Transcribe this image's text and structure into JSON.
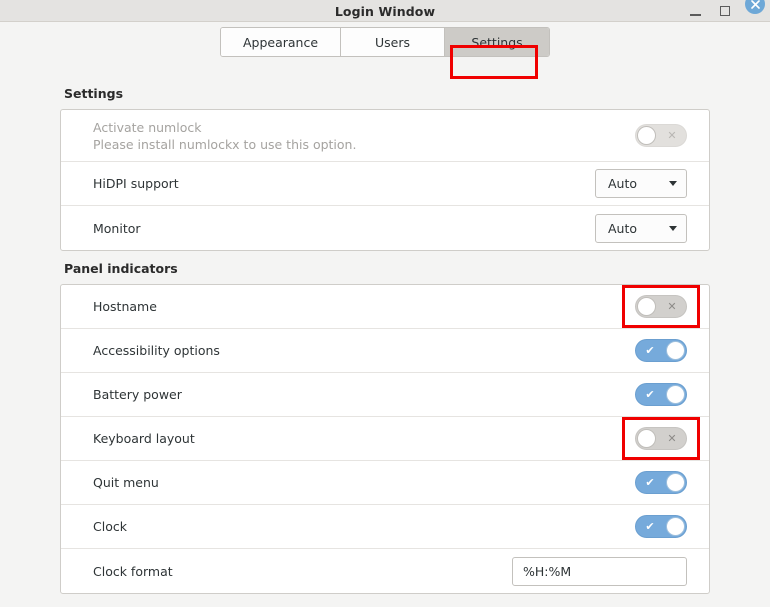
{
  "window": {
    "title": "Login Window",
    "controls": {
      "minimize": "minimize",
      "maximize": "maximize",
      "close": "close"
    }
  },
  "tabs": [
    {
      "label": "Appearance",
      "selected": false
    },
    {
      "label": "Users",
      "selected": false
    },
    {
      "label": "Settings",
      "selected": true,
      "highlighted": true
    }
  ],
  "sections": [
    {
      "title": "Settings",
      "rows": [
        {
          "label": "Activate numlock",
          "sublabel": "Please install numlockx to use this option.",
          "disabled": true,
          "control": "switch",
          "value": "off",
          "highlighted": false
        },
        {
          "label": "HiDPI support",
          "control": "dropdown",
          "value": "Auto",
          "highlighted": false
        },
        {
          "label": "Monitor",
          "control": "dropdown",
          "value": "Auto",
          "highlighted": false
        }
      ]
    },
    {
      "title": "Panel indicators",
      "rows": [
        {
          "label": "Hostname",
          "control": "switch",
          "value": "off",
          "highlighted": true
        },
        {
          "label": "Accessibility options",
          "control": "switch",
          "value": "on",
          "highlighted": false
        },
        {
          "label": "Battery power",
          "control": "switch",
          "value": "on",
          "highlighted": false
        },
        {
          "label": "Keyboard layout",
          "control": "switch",
          "value": "off",
          "highlighted": true
        },
        {
          "label": "Quit menu",
          "control": "switch",
          "value": "on",
          "highlighted": false
        },
        {
          "label": "Clock",
          "control": "switch",
          "value": "on",
          "highlighted": false
        },
        {
          "label": "Clock format",
          "control": "input",
          "value": "%H:%M",
          "highlighted": false
        }
      ]
    }
  ],
  "glyphs": {
    "switch_on": "✔",
    "switch_off": "✕"
  },
  "colors": {
    "accent_blue": "#76aadb",
    "highlight_red": "#f00000",
    "page_bg": "#f4f4f3",
    "titlebar_bg": "#e4e3e1"
  }
}
